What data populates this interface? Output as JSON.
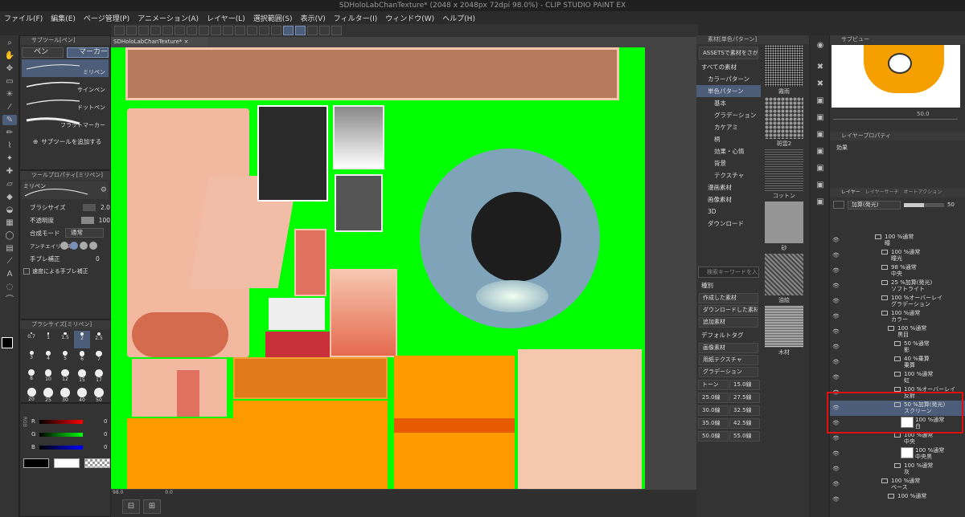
{
  "window": {
    "title": "SDHoloLabChanTexture* (2048 x 2048px 72dpi 98.0%) - CLIP STUDIO PAINT EX"
  },
  "menu": [
    "ファイル(F)",
    "編集(E)",
    "ページ管理(P)",
    "アニメーション(A)",
    "レイヤー(L)",
    "選択範囲(S)",
    "表示(V)",
    "フィルター(I)",
    "ウィンドウ(W)",
    "ヘルプ(H)"
  ],
  "subtool": {
    "header": "サブツール[ペン]",
    "tabs": [
      "ペン",
      "マーカー"
    ],
    "items": [
      "ミリペン",
      "サインペン",
      "ドットペン",
      "フラットマーカー"
    ],
    "add_label": "サブツールを追加する"
  },
  "toolprop": {
    "header": "ツールプロパティ[ミリペン]",
    "name": "ミリペン",
    "brush_size_label": "ブラシサイズ",
    "brush_size": "2.0",
    "opacity_label": "不透明度",
    "opacity": "100",
    "blend_label": "合成モード",
    "blend": "通常",
    "aa_label": "アンチエイリアス",
    "stab_label": "手ブレ補正",
    "stab": "0",
    "speed_label": "速度による手ブレ補正"
  },
  "brushsize": {
    "header": "ブラシサイズ[ミリペン]",
    "sizes": [
      "0.7",
      "1",
      "1.5",
      "2",
      "2.5",
      "3",
      "4",
      "5",
      "6",
      "7",
      "8",
      "10",
      "12",
      "15",
      "17",
      "20",
      "25",
      "30",
      "40",
      "50"
    ]
  },
  "color": {
    "r_label": "R",
    "g_label": "G",
    "b_label": "B",
    "mode_label": "RGB",
    "r": "0",
    "g": "0",
    "b": "0"
  },
  "canvas": {
    "tab": "SDHoloLabChanTexture*",
    "zoom": "98.0",
    "status_coords": "0.0"
  },
  "material": {
    "header": "素材[単色パターン]",
    "assets_button": "ASSETSで素材をさがす",
    "tree": [
      "すべての素材",
      "カラーパターン",
      "単色パターン",
      "基本",
      "グラデーション",
      "カケアミ",
      "柄",
      "効果・心情",
      "背景",
      "テクスチャ",
      "漫画素材",
      "画像素材",
      "3D",
      "ダウンロード"
    ],
    "search_placeholder": "検索キーワードを入力",
    "kind_label": "種別",
    "kind_buttons": [
      "作成した素材",
      "ダウンロードした素材",
      "追加素材"
    ],
    "tag_label": "デフォルトタグ",
    "tag_buttons": [
      "画像素材",
      "用紙テクスチャ",
      "グラデーション"
    ],
    "tone_grid": [
      "トーン",
      "15.0線",
      "25.0線",
      "27.5線",
      "30.0線",
      "32.5線",
      "35.0線",
      "42.5線",
      "50.0線",
      "55.0線"
    ],
    "thumbs": [
      "霧雨",
      "斑雲2",
      "コットン",
      "砂",
      "油絵",
      "木材"
    ]
  },
  "navigator": {
    "header": "サブビュー",
    "zoom": "50.0"
  },
  "layerprop": {
    "header": "レイヤープロパティ",
    "effect_label": "効果"
  },
  "layers": {
    "tabs": [
      "レイヤー",
      "レイヤーサーチ",
      "オートアクション"
    ],
    "blend": "加算(発光)",
    "opacity": "50",
    "items": [
      {
        "pct": "100 %通常",
        "name": "瞳",
        "indent": 1
      },
      {
        "pct": "100 %通常",
        "name": "瞳光",
        "indent": 2
      },
      {
        "pct": "98 %通常",
        "name": "中央",
        "indent": 2
      },
      {
        "pct": "25 %加算(発光)",
        "name": "ソフトライト",
        "indent": 2
      },
      {
        "pct": "100 %オーバーレイ",
        "name": "グラデーション",
        "indent": 2
      },
      {
        "pct": "100 %通常",
        "name": "カラー",
        "indent": 2
      },
      {
        "pct": "100 %通常",
        "name": "黒目",
        "indent": 3
      },
      {
        "pct": "50 %通常",
        "name": "影",
        "indent": 4
      },
      {
        "pct": "40 %乗算",
        "name": "乗算",
        "indent": 4
      },
      {
        "pct": "100 %通常",
        "name": "虹",
        "indent": 4
      },
      {
        "pct": "100 %オーバーレイ",
        "name": "反射",
        "indent": 4
      },
      {
        "pct": "50 %加算(発光)",
        "name": "スクリーン",
        "indent": 4
      },
      {
        "pct": "100 %通常",
        "name": "白",
        "indent": 5
      },
      {
        "pct": "100 %通常",
        "name": "中央",
        "indent": 4
      },
      {
        "pct": "100 %通常",
        "name": "中央黒",
        "indent": 5
      },
      {
        "pct": "100 %通常",
        "name": "灰",
        "indent": 4
      },
      {
        "pct": "100 %通常",
        "name": "ベース",
        "indent": 2
      },
      {
        "pct": "100 %通常",
        "name": "",
        "indent": 3
      }
    ]
  },
  "colors": {
    "accent": "#4c5d7a",
    "green": "#00ff00",
    "highlight_box": "#e01010"
  }
}
